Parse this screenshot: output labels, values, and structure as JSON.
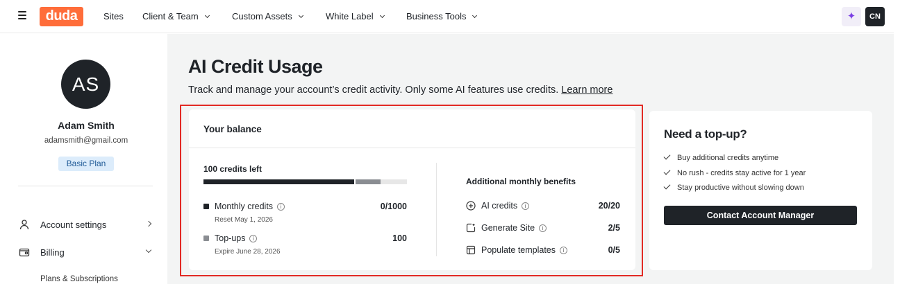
{
  "topnav": {
    "logo_text": "duda",
    "items": [
      {
        "label": "Sites",
        "has_dropdown": false
      },
      {
        "label": "Client & Team",
        "has_dropdown": true
      },
      {
        "label": "Custom Assets",
        "has_dropdown": true
      },
      {
        "label": "White Label",
        "has_dropdown": true
      },
      {
        "label": "Business Tools",
        "has_dropdown": true
      }
    ],
    "ai_icon": "sparkle-icon",
    "user_initials": "CN"
  },
  "sidebar": {
    "avatar_initials": "AS",
    "user_name": "Adam Smith",
    "user_email": "adamsmith@gmail.com",
    "plan_badge": "Basic Plan",
    "items": [
      {
        "label": "Account settings",
        "icon": "person-icon"
      },
      {
        "label": "Billing",
        "icon": "wallet-icon"
      }
    ],
    "sub_items": [
      {
        "label": "Plans & Subscriptions"
      }
    ]
  },
  "main": {
    "title": "AI Credit Usage",
    "description": "Track and manage your account’s credit activity. Only some AI features use credits.",
    "learn_more": "Learn more",
    "balance": {
      "title": "Your balance",
      "credits_left": "100 credits left",
      "bar_monthly_fraction": 0.74,
      "bar_topup_fraction": 0.13,
      "monthly": {
        "label": "Monthly credits",
        "value": "0/1000",
        "sub": "Reset May 1, 2026",
        "color": "#1f2328"
      },
      "topups": {
        "label": "Top-ups",
        "value": "100",
        "sub": "Expire June 28, 2026",
        "color": "#8a8d92"
      },
      "benefits_title": "Additional monthly benefits",
      "benefits": [
        {
          "label": "AI credits",
          "value": "20/20",
          "icon": "plus-circle-icon"
        },
        {
          "label": "Generate Site",
          "value": "2/5",
          "icon": "generate-site-icon"
        },
        {
          "label": "Populate templates",
          "value": "0/5",
          "icon": "template-icon"
        }
      ]
    },
    "topup": {
      "title": "Need a top-up?",
      "checks": [
        "Buy additional credits anytime",
        "No rush - credits stay active for 1 year",
        "Stay productive without slowing down"
      ],
      "button_label": "Contact Account Manager"
    }
  }
}
